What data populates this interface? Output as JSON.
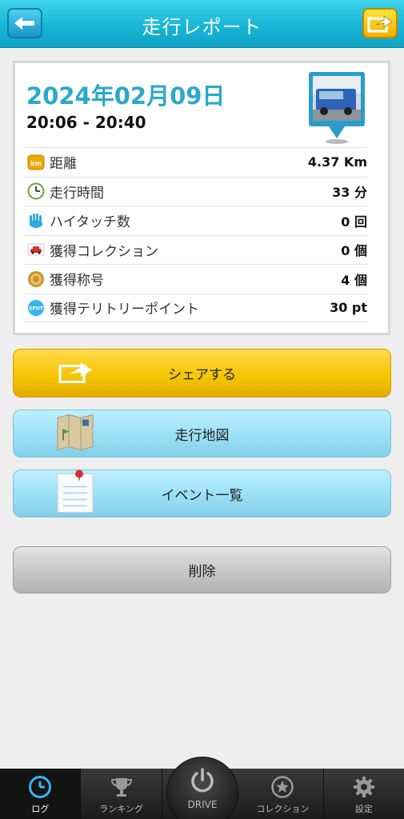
{
  "header": {
    "title": "走行レポート"
  },
  "report": {
    "date": "2024年02月09日",
    "time_range": "20:06 - 20:40",
    "stats": [
      {
        "icon": "km-icon",
        "icon_text": "km",
        "label": "距離",
        "value": "4.37 Km"
      },
      {
        "icon": "clock-icon",
        "label": "走行時間",
        "value": "33 分"
      },
      {
        "icon": "high-touch-hand-icon",
        "label": "ハイタッチ数",
        "value": "0 回"
      },
      {
        "icon": "car-collection-icon",
        "label": "獲得コレクション",
        "value": "0 個"
      },
      {
        "icon": "title-medal-icon",
        "label": "獲得称号",
        "value": "4 個"
      },
      {
        "icon": "spot-icon",
        "icon_text": "SPOT",
        "label": "獲得テリトリーポイント",
        "value": "30 pt"
      }
    ]
  },
  "actions": {
    "share": "シェアする",
    "map": "走行地図",
    "events": "イベント一覧",
    "delete": "削除"
  },
  "tabbar": {
    "log": "ログ",
    "ranking": "ランキング",
    "drive": "DRIVE",
    "collection": "コレクション",
    "settings": "設定"
  },
  "colors": {
    "header": "#17b6d6",
    "date": "#2ba9c9",
    "share_button": "#f5c400",
    "blue_button": "#9ee1f7",
    "active_tab_icon": "#36b4f0"
  }
}
